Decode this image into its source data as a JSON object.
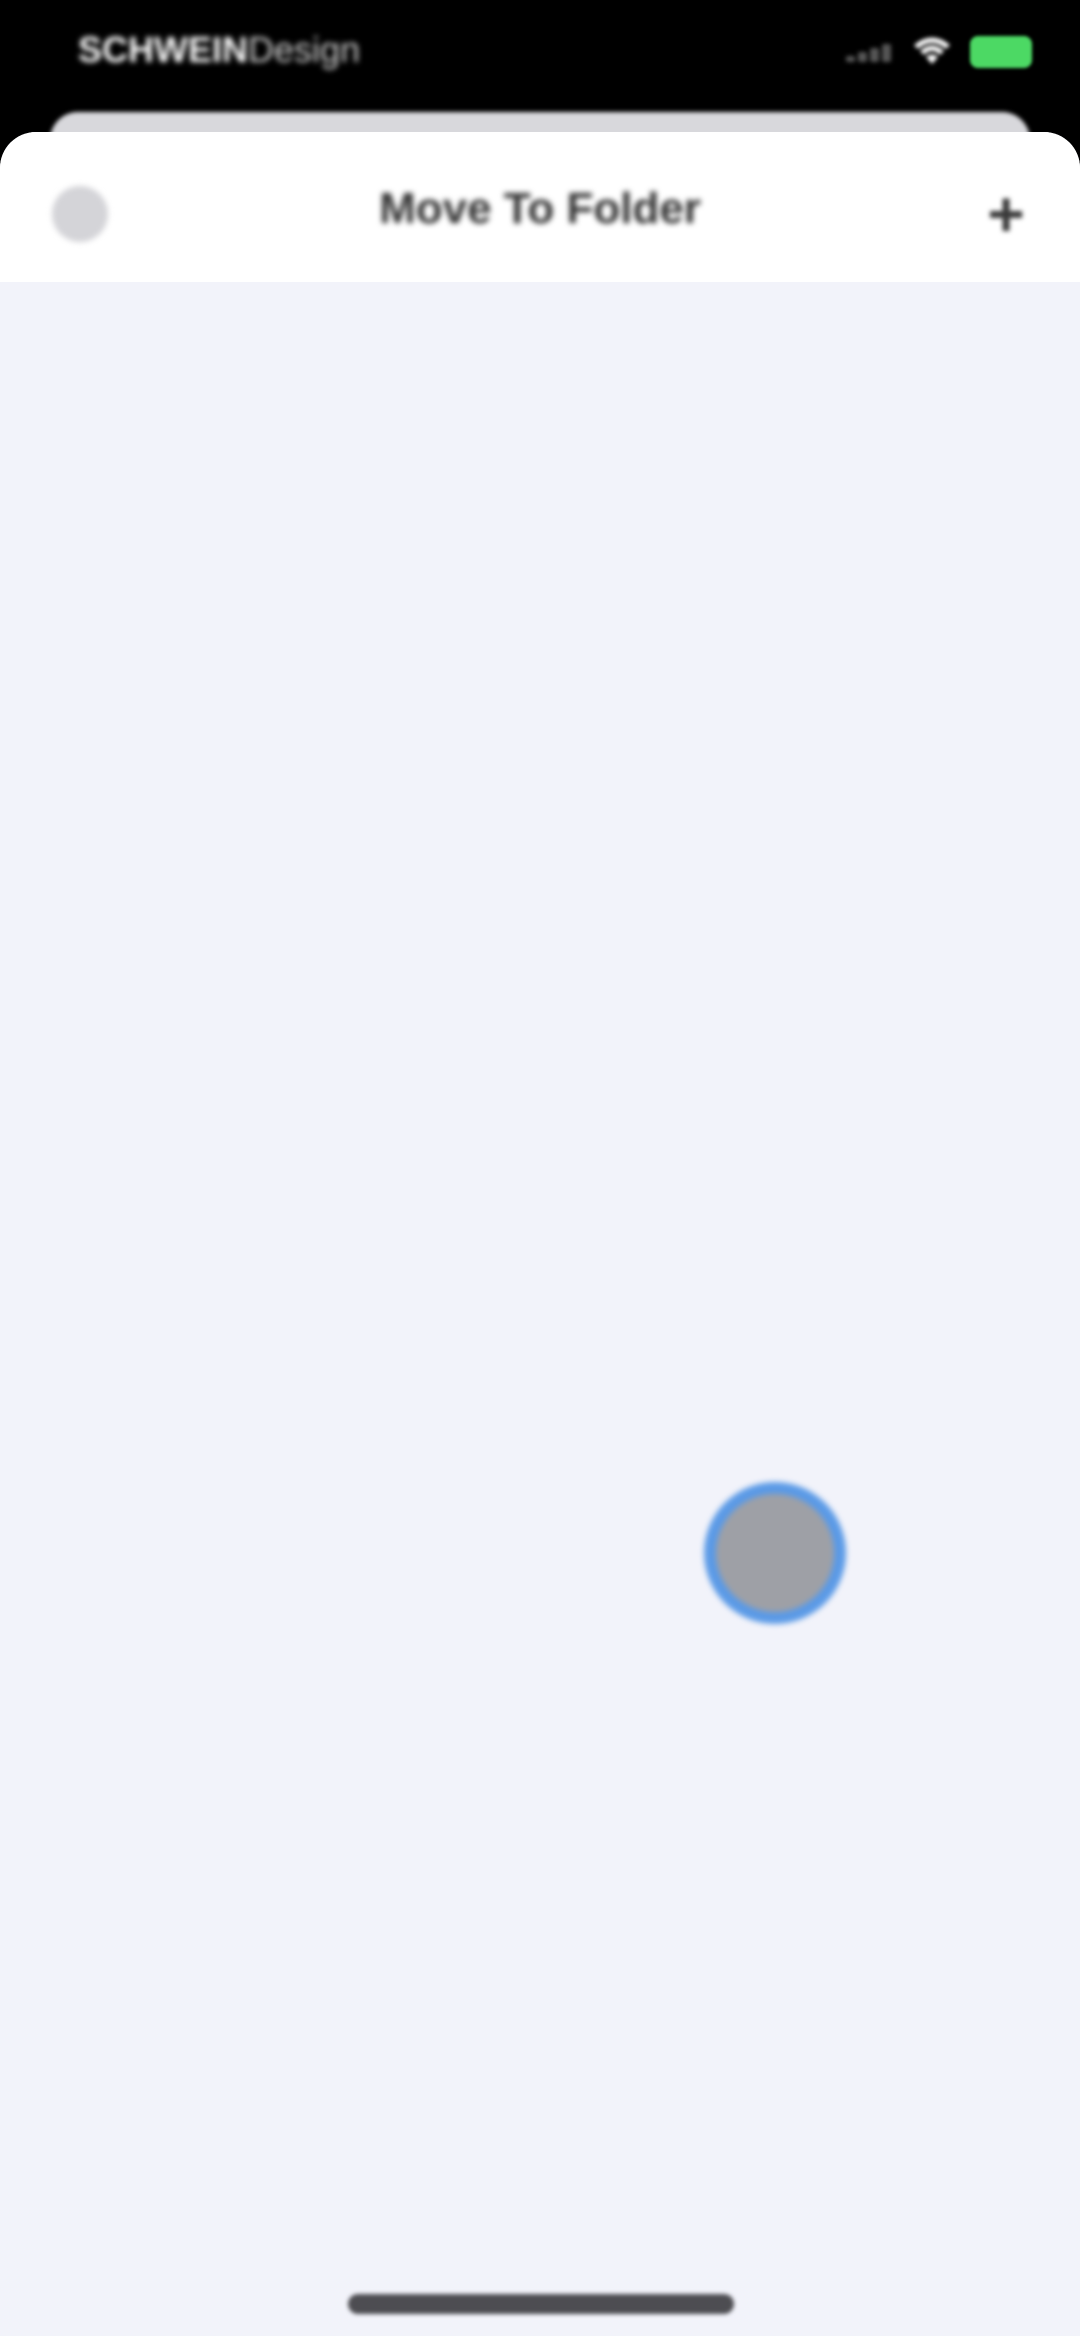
{
  "status_bar": {
    "carrier_bold": "SCHWEIN",
    "carrier_light": "Design"
  },
  "nav": {
    "title": "Move To Folder",
    "add_symbol": "+"
  },
  "colors": {
    "status_bar_bg": "#000000",
    "sheet_bg": "#f2f3fa",
    "nav_bg": "#ffffff",
    "battery": "#4cd964",
    "touch_ring": "#5b9ae6",
    "touch_fill": "#9ea0a6"
  },
  "icons": {
    "cancel": "circle-close-icon",
    "add": "plus-icon",
    "wifi": "wifi-icon",
    "battery": "battery-icon",
    "signal": "signal-icon"
  }
}
